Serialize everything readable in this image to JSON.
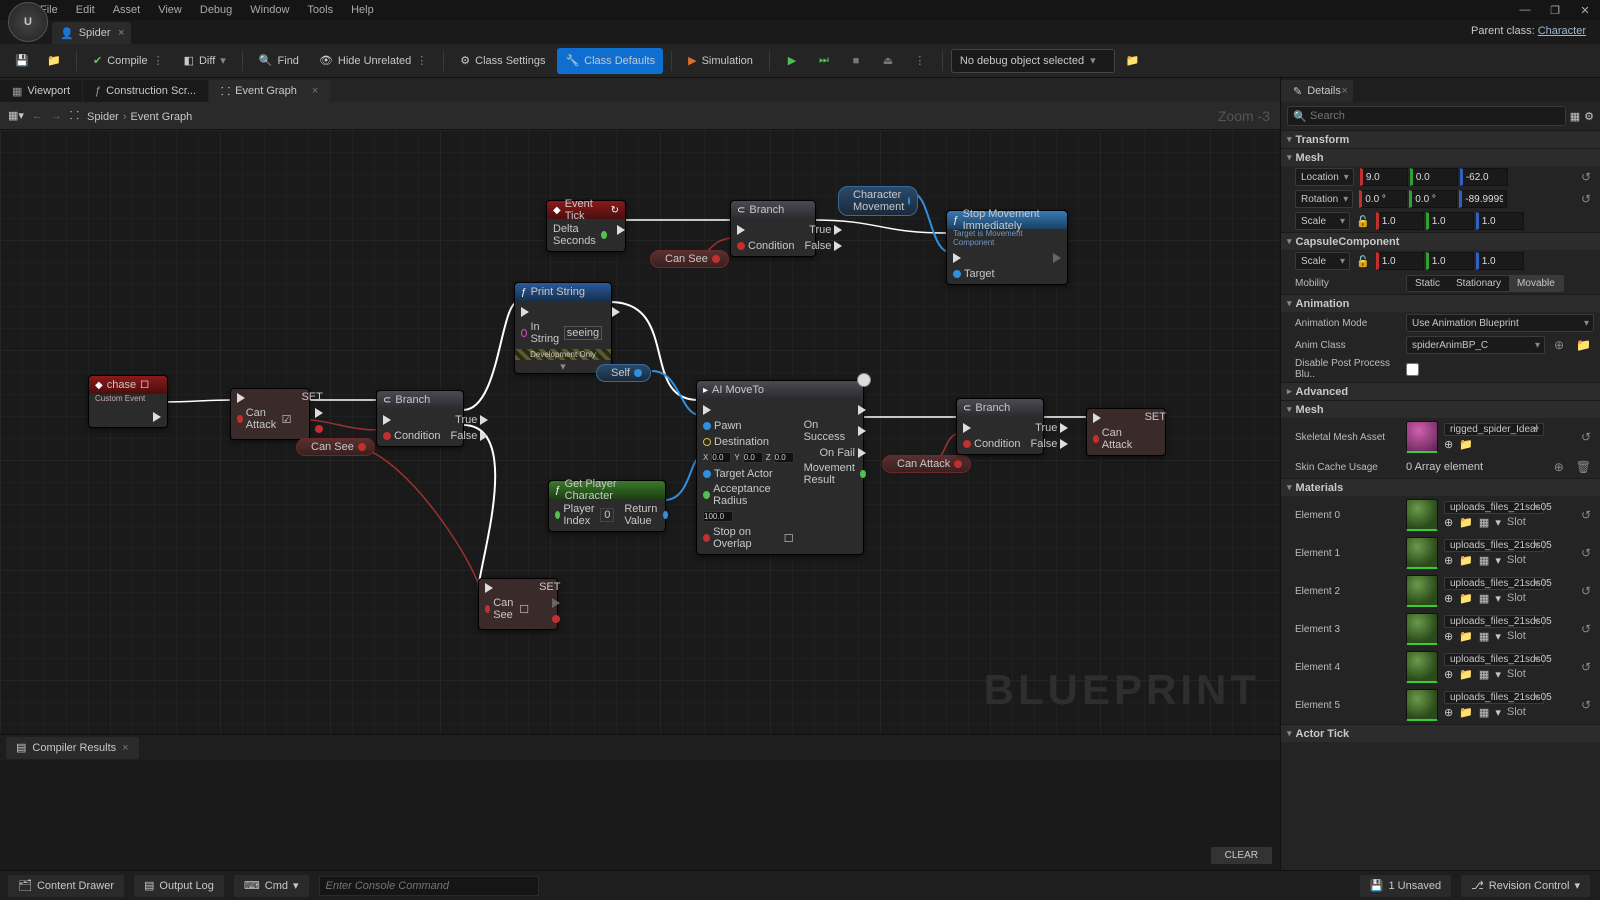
{
  "menu": [
    "File",
    "Edit",
    "Asset",
    "View",
    "Debug",
    "Window",
    "Tools",
    "Help"
  ],
  "file_tab": "Spider",
  "parent_class_label": "Parent class:",
  "parent_class": "Character",
  "toolbar": {
    "compile": "Compile",
    "diff": "Diff",
    "find": "Find",
    "hide_unrelated": "Hide Unrelated",
    "class_settings": "Class Settings",
    "class_defaults": "Class Defaults",
    "simulation": "Simulation",
    "debug_selector": "No debug object selected"
  },
  "graph_tabs": {
    "viewport": "Viewport",
    "construction": "Construction Scr...",
    "event_graph": "Event Graph"
  },
  "breadcrumb": {
    "root": "Spider",
    "leaf": "Event Graph"
  },
  "zoom": "Zoom -3",
  "watermark": "BLUEPRINT",
  "nodes": {
    "event_tick": "Event Tick",
    "delta_seconds": "Delta Seconds",
    "branch": "Branch",
    "condition": "Condition",
    "true": "True",
    "false": "False",
    "char_move": "Character Movement",
    "stop_move": "Stop Movement Immediately",
    "stop_move_sub": "Target is Movement Component",
    "target": "Target",
    "can_see": "Can See",
    "can_attack": "Can Attack",
    "self": "Self",
    "chase": "chase",
    "chase_sub": "Custom Event",
    "print_string": "Print String",
    "in_string": "In String",
    "in_string_val": "seeing",
    "dev_only": "Development Only",
    "ai_move": "AI MoveTo",
    "pawn": "Pawn",
    "destination": "Destination",
    "target_actor": "Target Actor",
    "accept_radius": "Acceptance Radius",
    "accept_val": "100.0",
    "stop_overlap": "Stop on Overlap",
    "on_success": "On Success",
    "on_fail": "On Fail",
    "move_result": "Movement Result",
    "dest_x": "0.0",
    "dest_y": "0.0",
    "dest_z": "0.0",
    "get_player": "Get Player Character",
    "player_index": "Player Index",
    "player_index_val": "0",
    "return_value": "Return Value",
    "set": "SET"
  },
  "details": {
    "title": "Details",
    "search_placeholder": "Search",
    "transform": "Transform",
    "mesh": "Mesh",
    "capsule": "CapsuleComponent",
    "animation": "Animation",
    "advanced": "Advanced",
    "materials": "Materials",
    "actor_tick": "Actor Tick",
    "location": "Location",
    "rotation": "Rotation",
    "scale": "Scale",
    "mobility": "Mobility",
    "loc": [
      "9.0",
      "0.0",
      "-62.0"
    ],
    "rot": [
      "0.0 °",
      "0.0 °",
      "-89.99999"
    ],
    "scl": [
      "1.0",
      "1.0",
      "1.0"
    ],
    "cap_scl": [
      "1.0",
      "1.0",
      "1.0"
    ],
    "static": "Static",
    "stationary": "Stationary",
    "movable": "Movable",
    "anim_mode": "Animation Mode",
    "anim_mode_val": "Use Animation Blueprint",
    "anim_class": "Anim Class",
    "anim_class_val": "spiderAnimBP_C",
    "disable_pp": "Disable Post Process Blu..",
    "skel_asset": "Skeletal Mesh Asset",
    "skel_asset_val": "rigged_spider_Ideal",
    "skin_cache": "Skin Cache Usage",
    "skin_cache_val": "0 Array element",
    "elements": [
      "Element 0",
      "Element 1",
      "Element 2",
      "Element 3",
      "Element 4",
      "Element 5"
    ],
    "mat_file": "uploads_files_21sds05",
    "slot": "Slot"
  },
  "compiler": "Compiler Results",
  "clear": "CLEAR",
  "status": {
    "content_drawer": "Content Drawer",
    "output_log": "Output Log",
    "cmd": "Cmd",
    "console": "Enter Console Command",
    "unsaved": "1 Unsaved",
    "revision": "Revision Control"
  }
}
